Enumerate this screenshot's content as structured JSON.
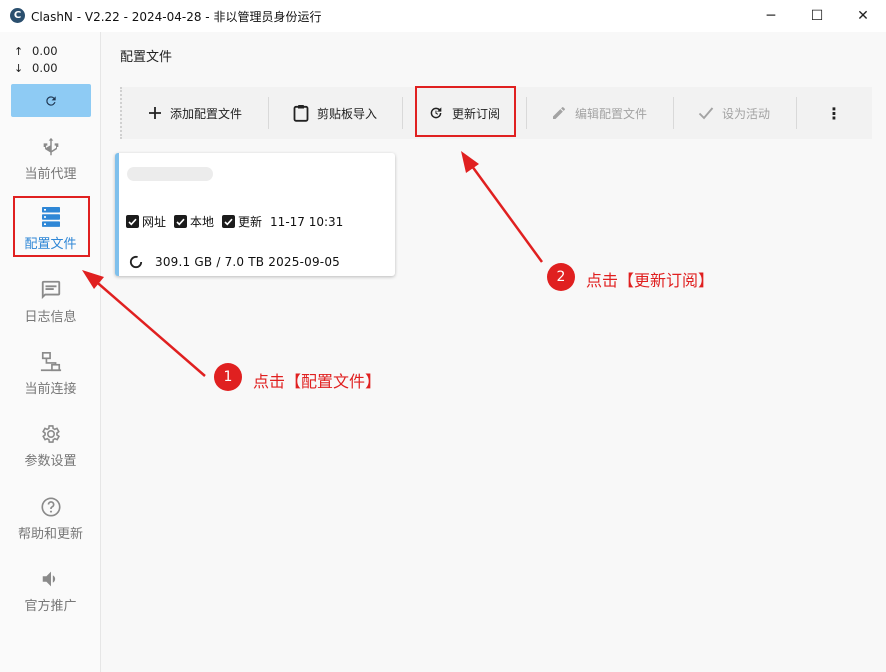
{
  "window": {
    "logo_letter": "C",
    "title": "ClashN - V2.22 - 2024-04-28 - 非以管理员身份运行",
    "minimize": "─",
    "maximize": "☐",
    "close": "✕"
  },
  "sidebar": {
    "upload_arrow": "↑",
    "upload_speed": "0.00",
    "download_arrow": "↓",
    "download_speed": "0.00",
    "items": [
      {
        "label": "当前代理",
        "icon": "proxy-hub-icon",
        "active": false
      },
      {
        "label": "配置文件",
        "icon": "server-stack-icon",
        "active": true
      },
      {
        "label": "日志信息",
        "icon": "message-icon",
        "active": false
      },
      {
        "label": "当前连接",
        "icon": "network-icon",
        "active": false
      },
      {
        "label": "参数设置",
        "icon": "gear-icon",
        "active": false
      },
      {
        "label": "帮助和更新",
        "icon": "help-icon",
        "active": false
      },
      {
        "label": "官方推广",
        "icon": "speaker-icon",
        "active": false
      }
    ]
  },
  "main": {
    "title": "配置文件",
    "toolbar": {
      "add_profile": "添加配置文件",
      "clipboard_import": "剪贴板导入",
      "update_subscription": "更新订阅",
      "edit_profile": "编辑配置文件",
      "set_active": "设为活动",
      "more": "⋮"
    },
    "card": {
      "flags": [
        {
          "label": "网址",
          "checked": true
        },
        {
          "label": "本地",
          "checked": true
        },
        {
          "label": "更新",
          "checked": true
        }
      ],
      "updated_time": "11-17 10:31",
      "usage": "309.1 GB  /  7.0 TB  2025-09-05"
    }
  },
  "annotations": {
    "step1_number": "1",
    "step1_text": "点击【配置文件】",
    "step2_number": "2",
    "step2_text": "点击【更新订阅】",
    "color": "#e02020"
  },
  "colors": {
    "accent": "#2f87d6",
    "refresh_button": "#8ecbf4",
    "card_stripe": "#7fc0ec"
  }
}
